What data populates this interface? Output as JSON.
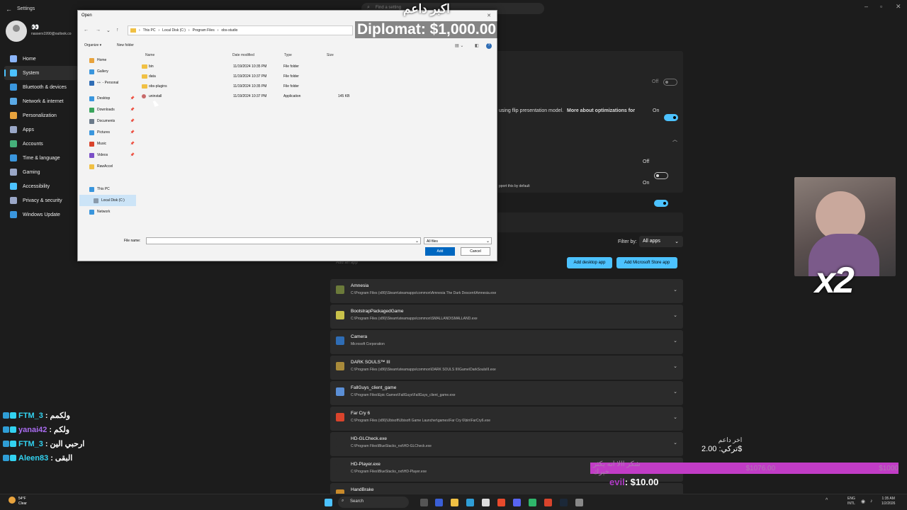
{
  "settings": {
    "title": "Settings",
    "search_placeholder": "Find a setting",
    "user": {
      "name": "👀",
      "email": "nasserx1990@outlook.co"
    },
    "nav": [
      {
        "label": "Home",
        "color": "#8ab4f8"
      },
      {
        "label": "System",
        "color": "#4cc2ff"
      },
      {
        "label": "Bluetooth & devices",
        "color": "#3a96dd"
      },
      {
        "label": "Network & internet",
        "color": "#5aa9e6"
      },
      {
        "label": "Personalization",
        "color": "#e8a33d"
      },
      {
        "label": "Apps",
        "color": "#9aa7c7"
      },
      {
        "label": "Accounts",
        "color": "#45b07a"
      },
      {
        "label": "Time & language",
        "color": "#3a96dd"
      },
      {
        "label": "Gaming",
        "color": "#9aa7c7"
      },
      {
        "label": "Accessibility",
        "color": "#4cc2ff"
      },
      {
        "label": "Privacy & security",
        "color": "#9aa7c7"
      },
      {
        "label": "Windows Update",
        "color": "#3a96dd"
      }
    ],
    "toggles": [
      {
        "label": "Off",
        "on": false
      },
      {
        "label": "On",
        "on": true
      },
      {
        "label": "Off",
        "on": false
      },
      {
        "label": "On",
        "on": true
      }
    ],
    "flip_text": "using flip presentation model.",
    "flip_link": "More about optimizations for",
    "default_text": "pport this by default",
    "filter_label": "Filter by:",
    "filter_value": "All apps",
    "add_an_app": "Add an app",
    "add_desktop_app": "Add desktop app",
    "add_store_app": "Add Microsoft Store app",
    "apps": [
      {
        "name": "Amnesia",
        "path": "C:\\Program Files (x86)\\Steam\\steamapps\\common\\Amnesia The Dark Descent\\Amnesia.exe",
        "color": "#6b7a3a"
      },
      {
        "name": "BootstrapPackagedGame",
        "path": "C:\\Program Files (x86)\\Steam\\steamapps\\common\\SMALLAND\\SMALLAND.exe",
        "color": "#c9c24a"
      },
      {
        "name": "Camera",
        "path": "Microsoft Corporation",
        "color": "#2f6db5"
      },
      {
        "name": "DARK SOULS™ III",
        "path": "C:\\Program Files (x86)\\Steam\\steamapps\\common\\DARK SOULS III\\Game\\DarkSoulsIII.exe",
        "color": "#a88a3a"
      },
      {
        "name": "FallGuys_client_game",
        "path": "C:\\Program Files\\Epic Games\\FallGuys\\FallGuys_client_game.exe",
        "color": "#5b8fd6"
      },
      {
        "name": "Far Cry 6",
        "path": "C:\\Program Files (x86)\\Ubisoft\\Ubisoft Game Launcher\\games\\Far Cry 6\\bin\\FarCry6.exe",
        "color": "#d9442c"
      },
      {
        "name": "HD-GLCheck.exe",
        "path": "C:\\Program Files\\BlueStacks_nxt\\HD-GLCheck.exe",
        "color": "#2b2b2b"
      },
      {
        "name": "HD-Player.exe",
        "path": "C:\\Program Files\\BlueStacks_nxt\\HD-Player.exe",
        "color": "#2b2b2b"
      },
      {
        "name": "HandBrake",
        "path": "",
        "color": "#c98a2a"
      }
    ]
  },
  "dialog": {
    "title": "Open",
    "breadcrumb": [
      "This PC",
      "Local Disk (C:)",
      "Program Files",
      "obs-studio"
    ],
    "organize": "Organize ▾",
    "new_folder": "New folder",
    "tree": [
      {
        "label": "Home",
        "icon": "home-icon",
        "color": "#e8a33d",
        "pin": false,
        "indent": false
      },
      {
        "label": "Gallery",
        "icon": "gallery-icon",
        "color": "#3a96dd",
        "pin": false,
        "indent": false
      },
      {
        "label": "👀 - Personal",
        "icon": "onedrive-icon",
        "color": "#2f6db5",
        "pin": false,
        "indent": false
      },
      {
        "label": "Desktop",
        "icon": "desktop-icon",
        "color": "#3a96dd",
        "pin": true,
        "indent": false
      },
      {
        "label": "Downloads",
        "icon": "downloads-icon",
        "color": "#3aa55d",
        "pin": true,
        "indent": false
      },
      {
        "label": "Documents",
        "icon": "documents-icon",
        "color": "#6b7a8a",
        "pin": true,
        "indent": false
      },
      {
        "label": "Pictures",
        "icon": "pictures-icon",
        "color": "#3a96dd",
        "pin": true,
        "indent": false
      },
      {
        "label": "Music",
        "icon": "music-icon",
        "color": "#d9442c",
        "pin": true,
        "indent": false
      },
      {
        "label": "Videos",
        "icon": "videos-icon",
        "color": "#7b4fc7",
        "pin": true,
        "indent": false
      },
      {
        "label": "RawAccel",
        "icon": "folder-icon",
        "color": "#f0c044",
        "pin": false,
        "indent": false
      },
      {
        "label": "This PC",
        "icon": "pc-icon",
        "color": "#3a96dd",
        "pin": false,
        "indent": false
      },
      {
        "label": "Local Disk (C:)",
        "icon": "drive-icon",
        "color": "#8a9aaa",
        "pin": false,
        "indent": true
      },
      {
        "label": "Network",
        "icon": "network-icon",
        "color": "#3a96dd",
        "pin": false,
        "indent": false
      }
    ],
    "columns": [
      "Name",
      "Date modified",
      "Type",
      "Size"
    ],
    "files": [
      {
        "name": "bin",
        "date": "11/19/2024 10:35 PM",
        "type": "File folder",
        "size": ""
      },
      {
        "name": "data",
        "date": "11/19/2024 10:37 PM",
        "type": "File folder",
        "size": ""
      },
      {
        "name": "obs-plugins",
        "date": "11/19/2024 10:35 PM",
        "type": "File folder",
        "size": ""
      },
      {
        "name": "uninstall",
        "date": "11/19/2024 10:37 PM",
        "type": "Application",
        "size": "145 KB"
      }
    ],
    "file_name_label": "File name:",
    "file_name_value": "",
    "filter": "All files",
    "add": "Add",
    "cancel": "Cancel"
  },
  "overlay": {
    "top_ar": "اكبر داعم",
    "diplomat": "Diplomat: $1,000.00",
    "x2": "x2",
    "chat": [
      {
        "user": "FTM_3",
        "msg": "ولكمم",
        "color": "#32d2f0"
      },
      {
        "user": "yanai42",
        "msg": "ولكم",
        "color": "#a96cf0"
      },
      {
        "user": "FTM_3",
        "msg": "ارحبي الين",
        "color": "#32d2f0"
      },
      {
        "user": "Aleen83",
        "msg": "البقى",
        "color": "#32d2f0"
      }
    ],
    "last_donor_title": "اخر داعم",
    "last_donor_amount": "تركي: 2.00$",
    "goal_text": "شكر االا انه يكثر خيرك",
    "goal_current": "$1076.00",
    "goal_target": "$1000",
    "goal_fraction": 1.0,
    "evil_user": "evil",
    "evil_amount": ": $10.00"
  },
  "taskbar": {
    "search": "Search",
    "lang1": "ENG",
    "lang2": "INTL",
    "time": "1:35 AM",
    "date": "1/2/2026",
    "weather_temp": "54°F",
    "weather_desc": "Clear"
  }
}
